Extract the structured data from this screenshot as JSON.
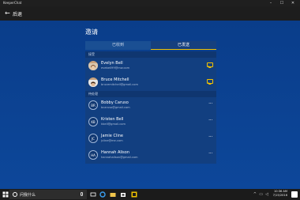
{
  "window": {
    "title": "KeeperChat",
    "min": "–",
    "max": "☐",
    "close": "✕"
  },
  "appbar": {
    "back_label": "后退"
  },
  "main": {
    "title": "邀请",
    "tabs": [
      {
        "label": "已收到"
      },
      {
        "label": "已发送"
      }
    ]
  },
  "accepted": {
    "header": "接受",
    "items": [
      {
        "name": "Evelyn Bell",
        "email": "evebell99@mw.com"
      },
      {
        "name": "Bruce Mitchell",
        "email": "brucemitchell@gmail.com"
      }
    ]
  },
  "pending": {
    "header": "待处理",
    "items": [
      {
        "initials": "BR",
        "name": "Bobby Caruso",
        "email": "bcaruso@gmail.com"
      },
      {
        "initials": "KB",
        "name": "Kristen Bell",
        "email": "kbell@gmail.com"
      },
      {
        "initials": "JC",
        "name": "Jamie Cline",
        "email": "jcline@me.com"
      },
      {
        "initials": "HA",
        "name": "Hannah Alison",
        "email": "hannahalison@gmail.com"
      }
    ],
    "more_label": "···"
  },
  "taskbar": {
    "search_placeholder": "问我什么",
    "time": "10:36 AM",
    "date": "7/15/2016"
  },
  "colors": {
    "accent": "#f2c200",
    "background": "#0b3f8a",
    "titlebar": "#1f1f1f"
  }
}
